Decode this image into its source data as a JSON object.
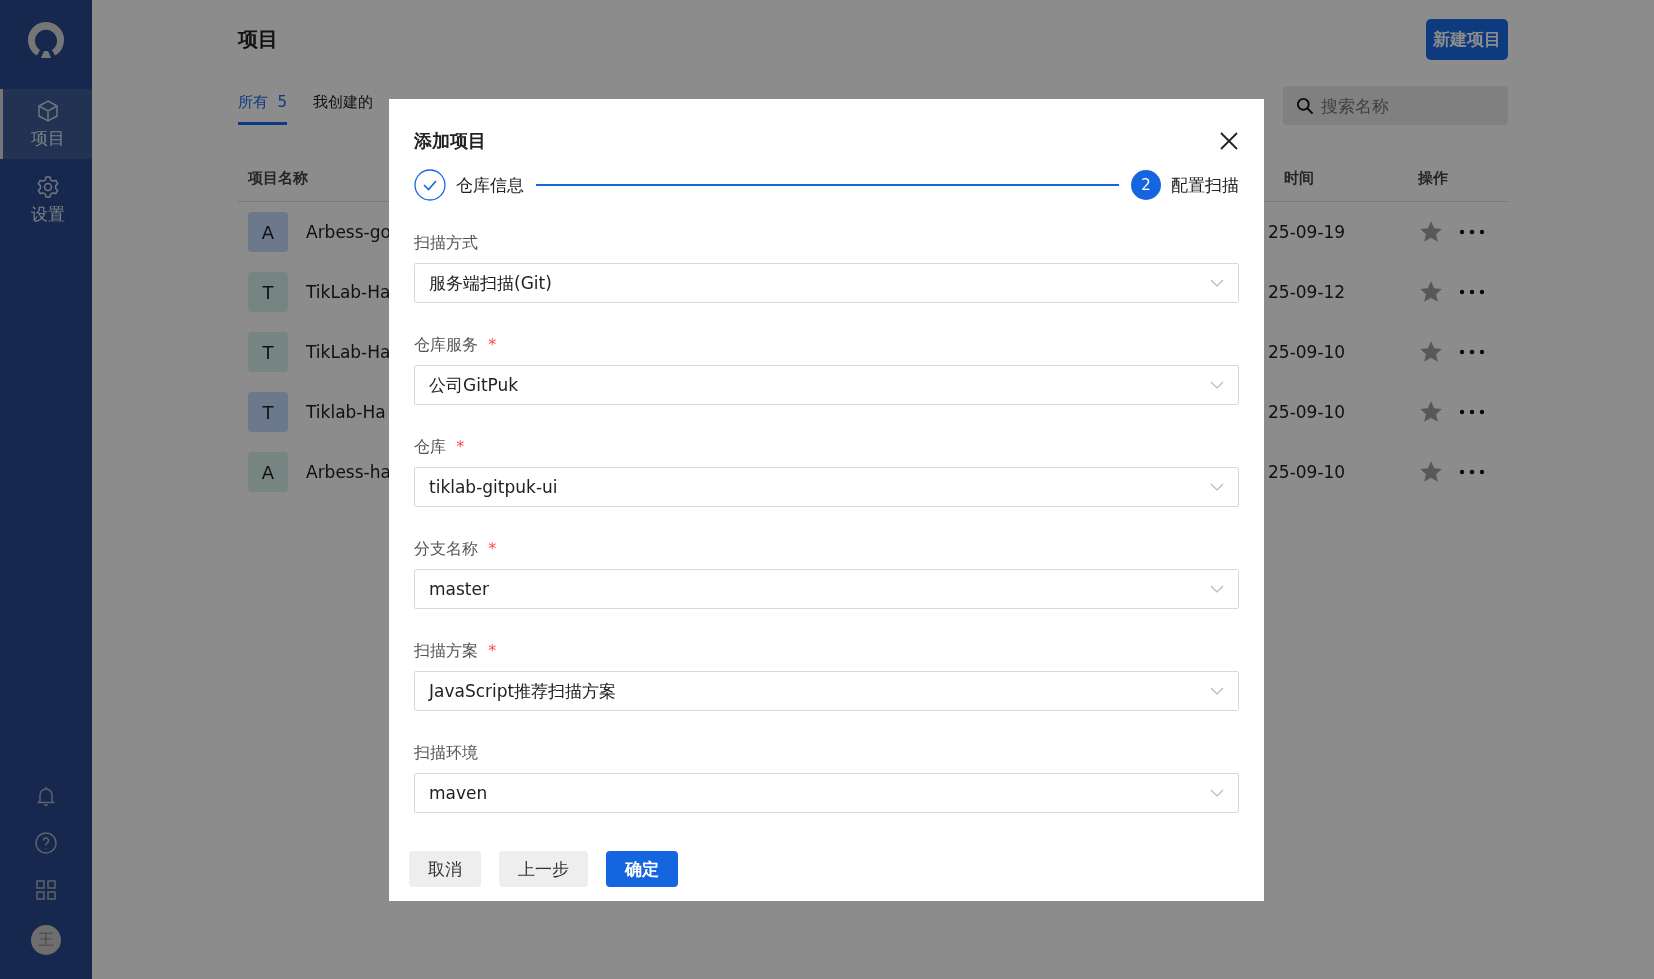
{
  "sidebar": {
    "items": [
      {
        "label": "项目",
        "selected": true
      },
      {
        "label": "设置",
        "selected": false
      }
    ],
    "avatar": "王"
  },
  "page": {
    "title": "项目",
    "new_button": "新建项目",
    "tabs": [
      {
        "label": "所有",
        "count": "5",
        "selected": true
      },
      {
        "label": "我创建的",
        "selected": false
      }
    ],
    "search": {
      "placeholder": "搜索名称"
    },
    "table": {
      "columns": [
        "项目名称",
        "时间",
        "操作"
      ],
      "rows": [
        {
          "initial": "A",
          "color": "#6c788c",
          "name": "Arbess-go",
          "date": "25-09-19"
        },
        {
          "initial": "T",
          "color": "#768581",
          "name": "TikLab-Ha",
          "date": "25-09-12"
        },
        {
          "initial": "T",
          "color": "#768581",
          "name": "TikLab-Ha",
          "date": "25-09-10"
        },
        {
          "initial": "T",
          "color": "#6c788c",
          "name": "Tiklab-Ha",
          "date": "25-09-10"
        },
        {
          "initial": "A",
          "color": "#768581",
          "name": "Arbess-ha",
          "date": "25-09-10"
        }
      ]
    }
  },
  "dialog": {
    "title": "添加项目",
    "steps": [
      {
        "label": "仓库信息",
        "done": true
      },
      {
        "label": "配置扫描",
        "number": "2",
        "done": false
      }
    ],
    "fields": [
      {
        "label": "扫描方式",
        "required": false,
        "value": "服务端扫描(Git)"
      },
      {
        "label": "仓库服务",
        "required": true,
        "value": "公司GitPuk"
      },
      {
        "label": "仓库",
        "required": true,
        "value": "tiklab-gitpuk-ui"
      },
      {
        "label": "分支名称",
        "required": true,
        "value": "master"
      },
      {
        "label": "扫描方案",
        "required": true,
        "value": "JavaScript推荐扫描方案"
      },
      {
        "label": "扫描环境",
        "required": false,
        "value": "maven"
      }
    ],
    "required_mark": "*",
    "buttons": [
      {
        "label": "取消",
        "kind": "secondary"
      },
      {
        "label": "上一步",
        "kind": "secondary"
      },
      {
        "label": "确定",
        "kind": "primary"
      }
    ]
  }
}
